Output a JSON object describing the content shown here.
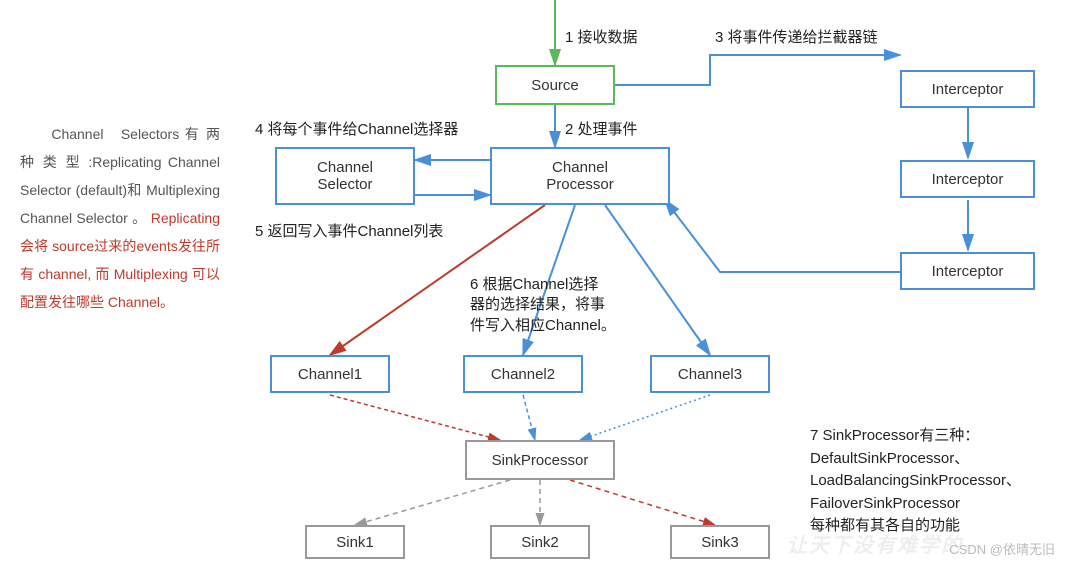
{
  "boxes": {
    "source": "Source",
    "channel_selector": "Channel\nSelector",
    "channel_processor": "Channel\nProcessor",
    "interceptor1": "Interceptor",
    "interceptor2": "Interceptor",
    "interceptor3": "Interceptor",
    "channel1": "Channel1",
    "channel2": "Channel2",
    "channel3": "Channel3",
    "sink_processor": "SinkProcessor",
    "sink1": "Sink1",
    "sink2": "Sink2",
    "sink3": "Sink3"
  },
  "labels": {
    "l1": "1 接收数据",
    "l2": "2 处理事件",
    "l3": "3 将事件传递给拦截器链",
    "l4": "4 将每个事件给Channel选择器",
    "l5": "5 返回写入事件Channel列表",
    "l6": "6 根据Channel选择\n器的选择结果，将事\n件写入相应Channel。",
    "l7": "7 SinkProcessor有三种：\nDefaultSinkProcessor、\nLoadBalancingSinkProcessor、\nFailoverSinkProcessor\n每种都有其各自的功能"
  },
  "sidebar": {
    "black": "　　Channel　Selectors 有 两 种 类 型 :Replicating Channel Selector (default)和 Multiplexing　　Channel Selector 。",
    "red": "Replicating 会将 source过来的events发往所有 channel, 而 Multiplexing 可以配置发往哪些 Channel。"
  },
  "watermark": "CSDN @依晴无旧",
  "watermark2": "让天下没有难学的"
}
